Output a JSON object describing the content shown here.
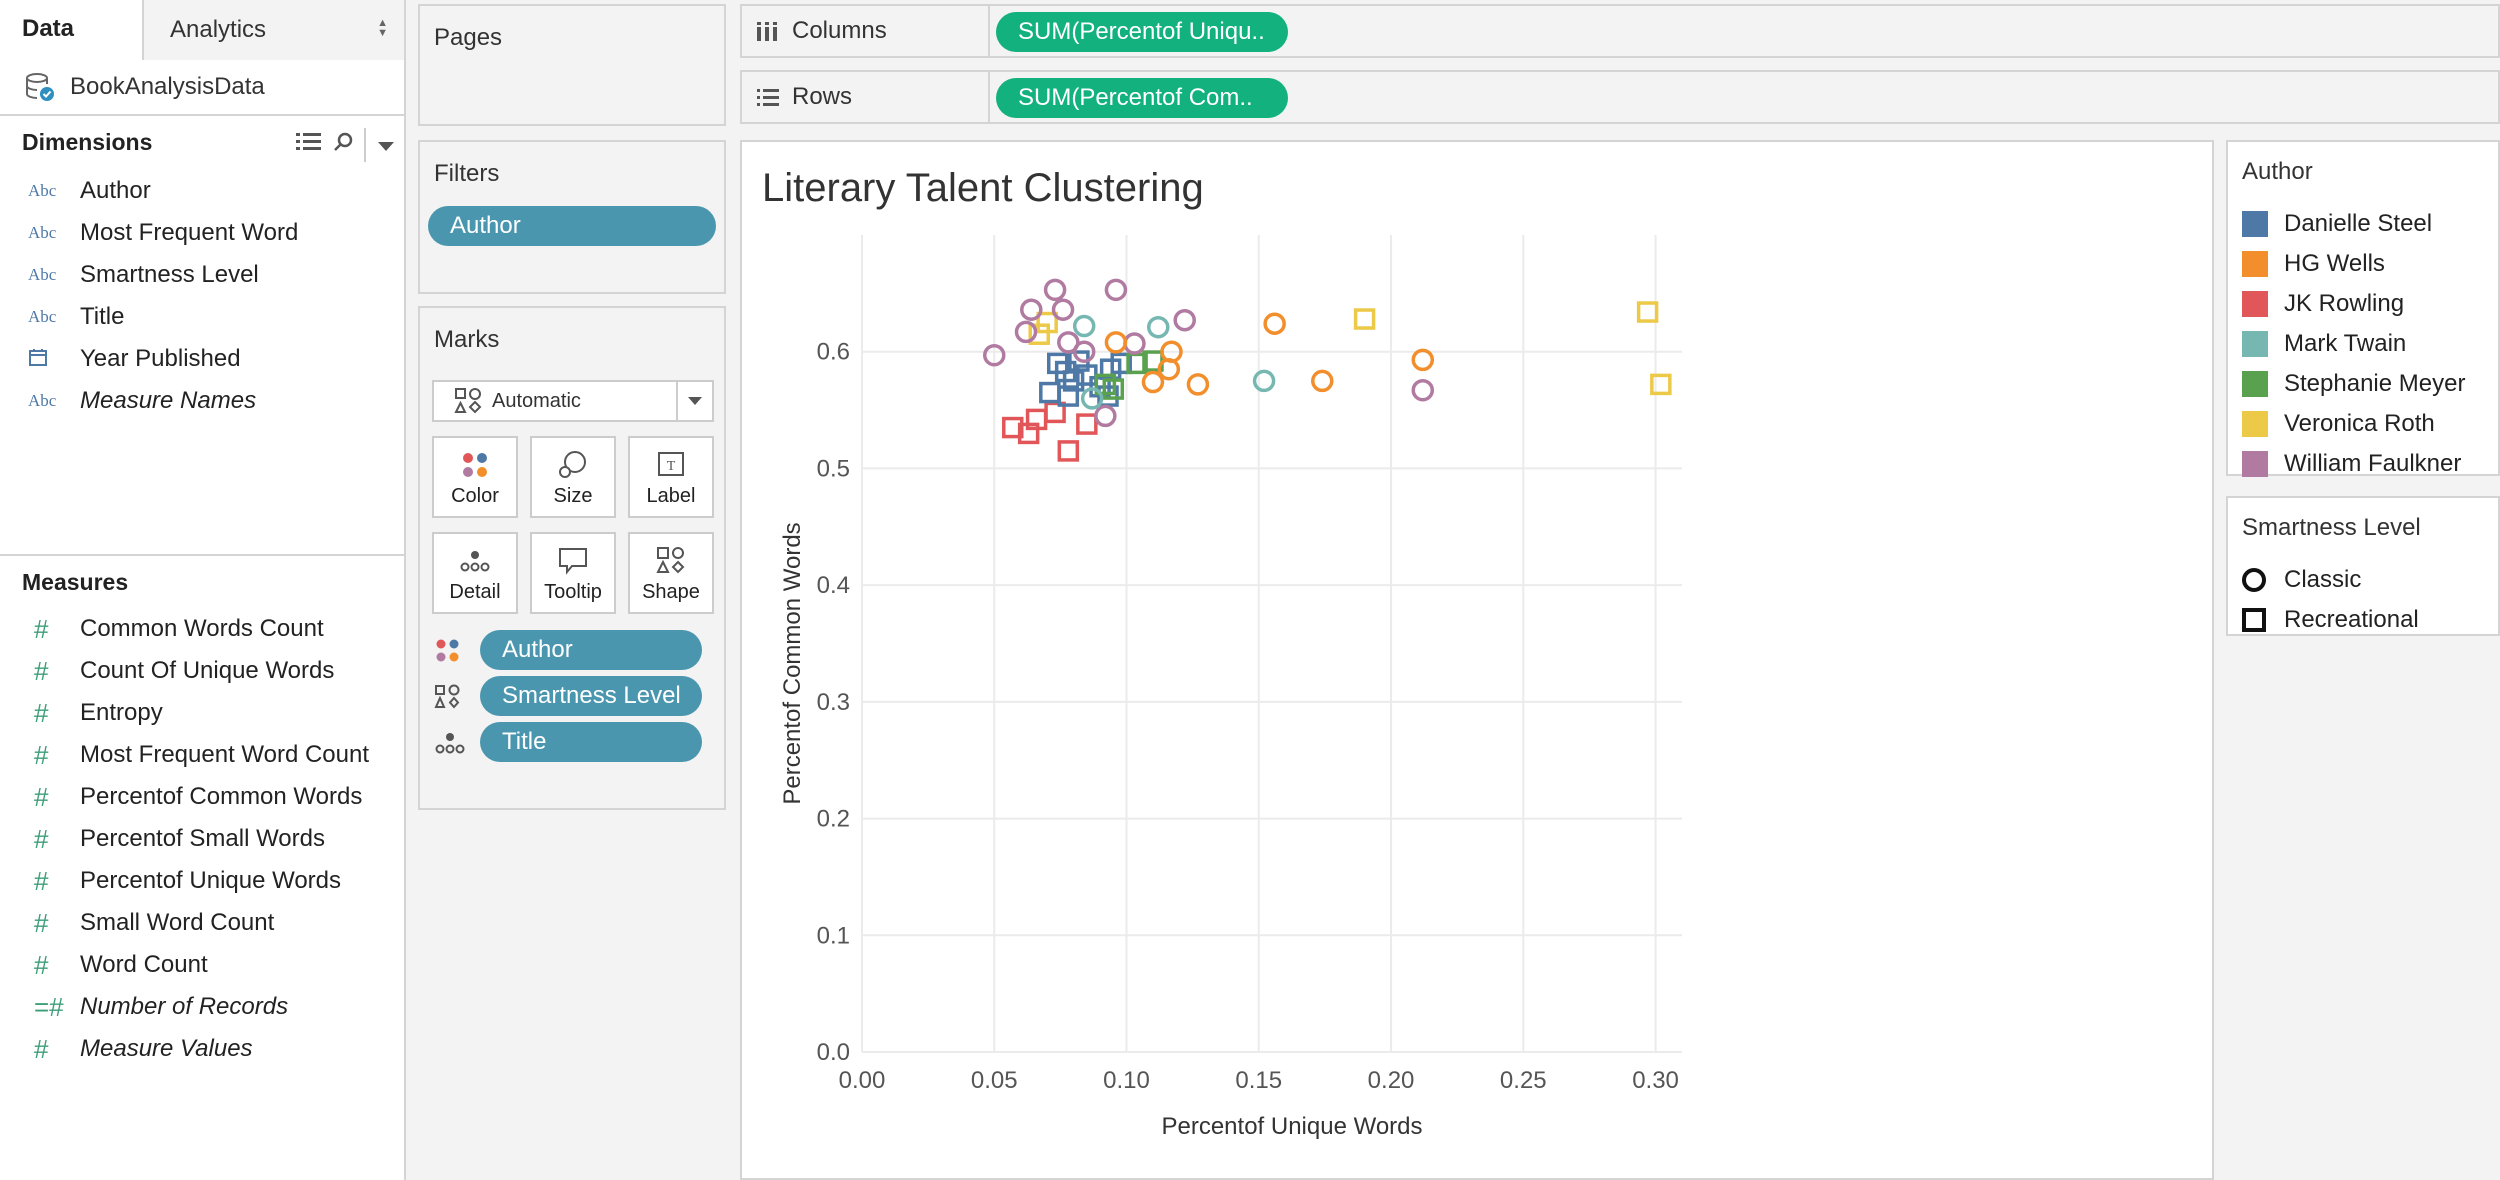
{
  "data_pane": {
    "tabs": {
      "data": "Data",
      "analytics": "Analytics"
    },
    "datasource": "BookAnalysisData",
    "dimensions_header": "Dimensions",
    "dimensions": [
      {
        "type": "Abc",
        "name": "Author",
        "italic": false
      },
      {
        "type": "Abc",
        "name": "Most Frequent Word",
        "italic": false
      },
      {
        "type": "Abc",
        "name": "Smartness Level",
        "italic": false
      },
      {
        "type": "Abc",
        "name": "Title",
        "italic": false
      },
      {
        "type": "calendar-icon",
        "name": "Year Published",
        "italic": false
      },
      {
        "type": "Abc",
        "name": "Measure Names",
        "italic": true
      }
    ],
    "measures_header": "Measures",
    "measures": [
      {
        "type": "#",
        "name": "Common Words Count",
        "italic": false
      },
      {
        "type": "#",
        "name": "Count Of Unique Words",
        "italic": false
      },
      {
        "type": "#",
        "name": "Entropy",
        "italic": false
      },
      {
        "type": "#",
        "name": "Most Frequent Word Count",
        "italic": false
      },
      {
        "type": "#",
        "name": "Percentof Common Words",
        "italic": false
      },
      {
        "type": "#",
        "name": "Percentof Small Words",
        "italic": false
      },
      {
        "type": "#",
        "name": "Percentof Unique Words",
        "italic": false
      },
      {
        "type": "#",
        "name": "Small Word Count",
        "italic": false
      },
      {
        "type": "#",
        "name": "Word Count",
        "italic": false
      },
      {
        "type": "=#",
        "name": "Number of Records",
        "italic": true
      },
      {
        "type": "#",
        "name": "Measure Values",
        "italic": true
      }
    ]
  },
  "cards": {
    "pages": "Pages",
    "filters": "Filters",
    "filter_pill": "Author",
    "marks": "Marks",
    "mark_type": "Automatic",
    "mark_buttons": {
      "color": "Color",
      "size": "Size",
      "label": "Label",
      "detail": "Detail",
      "tooltip": "Tooltip",
      "shape": "Shape"
    },
    "encodings": {
      "author": "Author",
      "smartness": "Smartness Level",
      "title": "Title"
    }
  },
  "shelves": {
    "columns_label": "Columns",
    "columns_pill": "SUM(Percentof Uniqu..",
    "rows_label": "Rows",
    "rows_pill": "SUM(Percentof Com.."
  },
  "view": {
    "title": "Literary Talent Clustering"
  },
  "legends": {
    "author_title": "Author",
    "authors": [
      {
        "name": "Danielle Steel",
        "color": "#4e79a7"
      },
      {
        "name": "HG Wells",
        "color": "#f28e2b"
      },
      {
        "name": "JK Rowling",
        "color": "#e15759"
      },
      {
        "name": "Mark Twain",
        "color": "#76b7b2"
      },
      {
        "name": "Stephanie Meyer",
        "color": "#59a14f"
      },
      {
        "name": "Veronica Roth",
        "color": "#edc948"
      },
      {
        "name": "William Faulkner",
        "color": "#b07aa1"
      }
    ],
    "smartness_title": "Smartness Level",
    "smartness": [
      {
        "name": "Classic",
        "shape": "circle"
      },
      {
        "name": "Recreational",
        "shape": "square"
      }
    ]
  },
  "chart_data": {
    "type": "scatter",
    "title": "Literary Talent Clustering",
    "xlabel": "Percentof Unique Words",
    "ylabel": "Percentof Common Words",
    "xlim": [
      0.0,
      0.31
    ],
    "ylim": [
      0.0,
      0.7
    ],
    "xticks": [
      "0.00",
      "0.05",
      "0.10",
      "0.15",
      "0.20",
      "0.25",
      "0.30"
    ],
    "yticks": [
      "0.0",
      "0.1",
      "0.2",
      "0.3",
      "0.4",
      "0.5",
      "0.6"
    ],
    "grid": true,
    "legend": "right",
    "points": [
      {
        "x": 0.057,
        "y": 0.535,
        "author": "JK Rowling",
        "shape": "square"
      },
      {
        "x": 0.063,
        "y": 0.53,
        "author": "JK Rowling",
        "shape": "square"
      },
      {
        "x": 0.066,
        "y": 0.542,
        "author": "JK Rowling",
        "shape": "square"
      },
      {
        "x": 0.073,
        "y": 0.548,
        "author": "JK Rowling",
        "shape": "square"
      },
      {
        "x": 0.078,
        "y": 0.515,
        "author": "JK Rowling",
        "shape": "square"
      },
      {
        "x": 0.085,
        "y": 0.538,
        "author": "JK Rowling",
        "shape": "square"
      },
      {
        "x": 0.071,
        "y": 0.565,
        "author": "Danielle Steel",
        "shape": "square"
      },
      {
        "x": 0.074,
        "y": 0.59,
        "author": "Danielle Steel",
        "shape": "square"
      },
      {
        "x": 0.077,
        "y": 0.583,
        "author": "Danielle Steel",
        "shape": "square"
      },
      {
        "x": 0.078,
        "y": 0.562,
        "author": "Danielle Steel",
        "shape": "square"
      },
      {
        "x": 0.08,
        "y": 0.575,
        "author": "Danielle Steel",
        "shape": "square"
      },
      {
        "x": 0.082,
        "y": 0.592,
        "author": "Danielle Steel",
        "shape": "square"
      },
      {
        "x": 0.085,
        "y": 0.58,
        "author": "Danielle Steel",
        "shape": "square"
      },
      {
        "x": 0.09,
        "y": 0.57,
        "author": "Danielle Steel",
        "shape": "square"
      },
      {
        "x": 0.093,
        "y": 0.562,
        "author": "Danielle Steel",
        "shape": "square"
      },
      {
        "x": 0.094,
        "y": 0.585,
        "author": "Danielle Steel",
        "shape": "square"
      },
      {
        "x": 0.098,
        "y": 0.59,
        "author": "Danielle Steel",
        "shape": "square"
      },
      {
        "x": 0.092,
        "y": 0.572,
        "author": "Stephanie Meyer",
        "shape": "square"
      },
      {
        "x": 0.095,
        "y": 0.568,
        "author": "Stephanie Meyer",
        "shape": "square"
      },
      {
        "x": 0.104,
        "y": 0.59,
        "author": "Stephanie Meyer",
        "shape": "square"
      },
      {
        "x": 0.11,
        "y": 0.592,
        "author": "Stephanie Meyer",
        "shape": "square"
      },
      {
        "x": 0.067,
        "y": 0.615,
        "author": "Veronica Roth",
        "shape": "square"
      },
      {
        "x": 0.07,
        "y": 0.625,
        "author": "Veronica Roth",
        "shape": "square"
      },
      {
        "x": 0.19,
        "y": 0.628,
        "author": "Veronica Roth",
        "shape": "square"
      },
      {
        "x": 0.297,
        "y": 0.634,
        "author": "Veronica Roth",
        "shape": "square"
      },
      {
        "x": 0.302,
        "y": 0.572,
        "author": "Veronica Roth",
        "shape": "square"
      },
      {
        "x": 0.05,
        "y": 0.597,
        "author": "William Faulkner",
        "shape": "circle"
      },
      {
        "x": 0.062,
        "y": 0.617,
        "author": "William Faulkner",
        "shape": "circle"
      },
      {
        "x": 0.064,
        "y": 0.636,
        "author": "William Faulkner",
        "shape": "circle"
      },
      {
        "x": 0.073,
        "y": 0.653,
        "author": "William Faulkner",
        "shape": "circle"
      },
      {
        "x": 0.076,
        "y": 0.636,
        "author": "William Faulkner",
        "shape": "circle"
      },
      {
        "x": 0.078,
        "y": 0.608,
        "author": "William Faulkner",
        "shape": "circle"
      },
      {
        "x": 0.084,
        "y": 0.6,
        "author": "William Faulkner",
        "shape": "circle"
      },
      {
        "x": 0.092,
        "y": 0.545,
        "author": "William Faulkner",
        "shape": "circle"
      },
      {
        "x": 0.096,
        "y": 0.653,
        "author": "William Faulkner",
        "shape": "circle"
      },
      {
        "x": 0.103,
        "y": 0.607,
        "author": "William Faulkner",
        "shape": "circle"
      },
      {
        "x": 0.122,
        "y": 0.627,
        "author": "William Faulkner",
        "shape": "circle"
      },
      {
        "x": 0.212,
        "y": 0.567,
        "author": "William Faulkner",
        "shape": "circle"
      },
      {
        "x": 0.084,
        "y": 0.622,
        "author": "Mark Twain",
        "shape": "circle"
      },
      {
        "x": 0.112,
        "y": 0.621,
        "author": "Mark Twain",
        "shape": "circle"
      },
      {
        "x": 0.152,
        "y": 0.575,
        "author": "Mark Twain",
        "shape": "circle"
      },
      {
        "x": 0.087,
        "y": 0.56,
        "author": "Mark Twain",
        "shape": "circle"
      },
      {
        "x": 0.096,
        "y": 0.608,
        "author": "HG Wells",
        "shape": "circle"
      },
      {
        "x": 0.11,
        "y": 0.574,
        "author": "HG Wells",
        "shape": "circle"
      },
      {
        "x": 0.117,
        "y": 0.6,
        "author": "HG Wells",
        "shape": "circle"
      },
      {
        "x": 0.116,
        "y": 0.585,
        "author": "HG Wells",
        "shape": "circle"
      },
      {
        "x": 0.127,
        "y": 0.572,
        "author": "HG Wells",
        "shape": "circle"
      },
      {
        "x": 0.156,
        "y": 0.624,
        "author": "HG Wells",
        "shape": "circle"
      },
      {
        "x": 0.174,
        "y": 0.575,
        "author": "HG Wells",
        "shape": "circle"
      },
      {
        "x": 0.212,
        "y": 0.593,
        "author": "HG Wells",
        "shape": "circle"
      }
    ]
  }
}
